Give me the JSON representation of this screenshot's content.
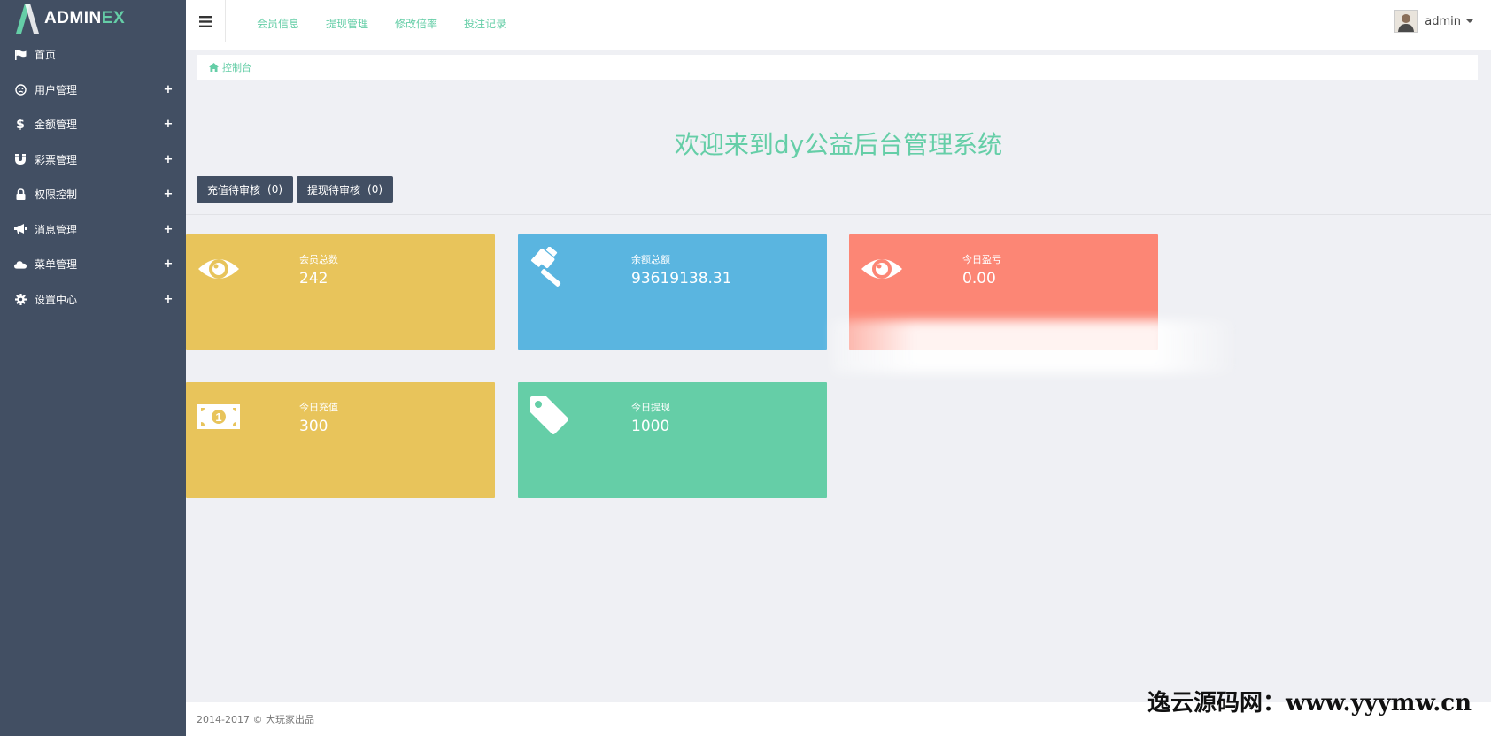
{
  "logo": {
    "text_main": "ADMIN",
    "text_accent": "EX",
    "accent_color": "#65cea7"
  },
  "sidebar": {
    "background": "#424f63",
    "items": [
      {
        "label": "首页",
        "icon": "flag-icon",
        "expandable": false
      },
      {
        "label": "用户管理",
        "icon": "user-circle-icon",
        "expandable": true
      },
      {
        "label": "金额管理",
        "icon": "dollar-icon",
        "expandable": true
      },
      {
        "label": "彩票管理",
        "icon": "magnet-icon",
        "expandable": true
      },
      {
        "label": "权限控制",
        "icon": "lock-icon",
        "expandable": true
      },
      {
        "label": "消息管理",
        "icon": "bullhorn-icon",
        "expandable": true
      },
      {
        "label": "菜单管理",
        "icon": "cloud-icon",
        "expandable": true
      },
      {
        "label": "设置中心",
        "icon": "gear-icon",
        "expandable": true
      }
    ],
    "expand_symbol": "+"
  },
  "header": {
    "links": [
      "会员信息",
      "提现管理",
      "修改倍率",
      "投注记录"
    ],
    "user": {
      "name": "admin"
    }
  },
  "breadcrumb": {
    "label": "控制台"
  },
  "main": {
    "welcome": "欢迎来到dy公益后台管理系统",
    "buttons": [
      {
        "label": "充值待审核",
        "count": "(0)"
      },
      {
        "label": "提现待审核",
        "count": "(0)"
      }
    ],
    "cards": [
      {
        "title": "会员总数",
        "value": "242",
        "color": "#e8c45b",
        "icon": "eye-icon"
      },
      {
        "title": "余额总额",
        "value": "93619138.31",
        "color": "#5ab5e0",
        "icon": "gavel-icon"
      },
      {
        "title": "今日盈亏",
        "value": "0.00",
        "color": "#fc8675",
        "icon": "eye-icon"
      },
      {
        "title": "今日充值",
        "value": "300",
        "color": "#e8c45b",
        "icon": "money-icon"
      },
      {
        "title": "今日提现",
        "value": "1000",
        "color": "#65cea7",
        "icon": "tag-icon"
      }
    ]
  },
  "footer": {
    "text": "2014-2017 © 大玩家出品"
  },
  "watermark": {
    "text": "逸云源码网：www.yyymw.cn"
  }
}
